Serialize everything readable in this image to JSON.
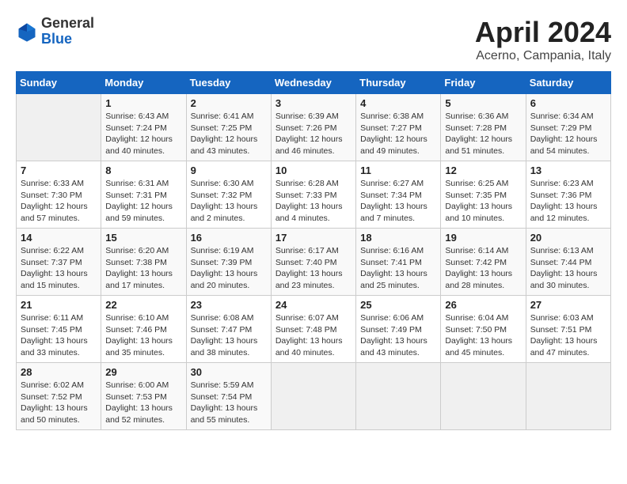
{
  "header": {
    "logo": {
      "general": "General",
      "blue": "Blue"
    },
    "month": "April 2024",
    "location": "Acerno, Campania, Italy"
  },
  "weekdays": [
    "Sunday",
    "Monday",
    "Tuesday",
    "Wednesday",
    "Thursday",
    "Friday",
    "Saturday"
  ],
  "weeks": [
    [
      {
        "day": "",
        "info": ""
      },
      {
        "day": "1",
        "info": "Sunrise: 6:43 AM\nSunset: 7:24 PM\nDaylight: 12 hours\nand 40 minutes."
      },
      {
        "day": "2",
        "info": "Sunrise: 6:41 AM\nSunset: 7:25 PM\nDaylight: 12 hours\nand 43 minutes."
      },
      {
        "day": "3",
        "info": "Sunrise: 6:39 AM\nSunset: 7:26 PM\nDaylight: 12 hours\nand 46 minutes."
      },
      {
        "day": "4",
        "info": "Sunrise: 6:38 AM\nSunset: 7:27 PM\nDaylight: 12 hours\nand 49 minutes."
      },
      {
        "day": "5",
        "info": "Sunrise: 6:36 AM\nSunset: 7:28 PM\nDaylight: 12 hours\nand 51 minutes."
      },
      {
        "day": "6",
        "info": "Sunrise: 6:34 AM\nSunset: 7:29 PM\nDaylight: 12 hours\nand 54 minutes."
      }
    ],
    [
      {
        "day": "7",
        "info": "Sunrise: 6:33 AM\nSunset: 7:30 PM\nDaylight: 12 hours\nand 57 minutes."
      },
      {
        "day": "8",
        "info": "Sunrise: 6:31 AM\nSunset: 7:31 PM\nDaylight: 12 hours\nand 59 minutes."
      },
      {
        "day": "9",
        "info": "Sunrise: 6:30 AM\nSunset: 7:32 PM\nDaylight: 13 hours\nand 2 minutes."
      },
      {
        "day": "10",
        "info": "Sunrise: 6:28 AM\nSunset: 7:33 PM\nDaylight: 13 hours\nand 4 minutes."
      },
      {
        "day": "11",
        "info": "Sunrise: 6:27 AM\nSunset: 7:34 PM\nDaylight: 13 hours\nand 7 minutes."
      },
      {
        "day": "12",
        "info": "Sunrise: 6:25 AM\nSunset: 7:35 PM\nDaylight: 13 hours\nand 10 minutes."
      },
      {
        "day": "13",
        "info": "Sunrise: 6:23 AM\nSunset: 7:36 PM\nDaylight: 13 hours\nand 12 minutes."
      }
    ],
    [
      {
        "day": "14",
        "info": "Sunrise: 6:22 AM\nSunset: 7:37 PM\nDaylight: 13 hours\nand 15 minutes."
      },
      {
        "day": "15",
        "info": "Sunrise: 6:20 AM\nSunset: 7:38 PM\nDaylight: 13 hours\nand 17 minutes."
      },
      {
        "day": "16",
        "info": "Sunrise: 6:19 AM\nSunset: 7:39 PM\nDaylight: 13 hours\nand 20 minutes."
      },
      {
        "day": "17",
        "info": "Sunrise: 6:17 AM\nSunset: 7:40 PM\nDaylight: 13 hours\nand 23 minutes."
      },
      {
        "day": "18",
        "info": "Sunrise: 6:16 AM\nSunset: 7:41 PM\nDaylight: 13 hours\nand 25 minutes."
      },
      {
        "day": "19",
        "info": "Sunrise: 6:14 AM\nSunset: 7:42 PM\nDaylight: 13 hours\nand 28 minutes."
      },
      {
        "day": "20",
        "info": "Sunrise: 6:13 AM\nSunset: 7:44 PM\nDaylight: 13 hours\nand 30 minutes."
      }
    ],
    [
      {
        "day": "21",
        "info": "Sunrise: 6:11 AM\nSunset: 7:45 PM\nDaylight: 13 hours\nand 33 minutes."
      },
      {
        "day": "22",
        "info": "Sunrise: 6:10 AM\nSunset: 7:46 PM\nDaylight: 13 hours\nand 35 minutes."
      },
      {
        "day": "23",
        "info": "Sunrise: 6:08 AM\nSunset: 7:47 PM\nDaylight: 13 hours\nand 38 minutes."
      },
      {
        "day": "24",
        "info": "Sunrise: 6:07 AM\nSunset: 7:48 PM\nDaylight: 13 hours\nand 40 minutes."
      },
      {
        "day": "25",
        "info": "Sunrise: 6:06 AM\nSunset: 7:49 PM\nDaylight: 13 hours\nand 43 minutes."
      },
      {
        "day": "26",
        "info": "Sunrise: 6:04 AM\nSunset: 7:50 PM\nDaylight: 13 hours\nand 45 minutes."
      },
      {
        "day": "27",
        "info": "Sunrise: 6:03 AM\nSunset: 7:51 PM\nDaylight: 13 hours\nand 47 minutes."
      }
    ],
    [
      {
        "day": "28",
        "info": "Sunrise: 6:02 AM\nSunset: 7:52 PM\nDaylight: 13 hours\nand 50 minutes."
      },
      {
        "day": "29",
        "info": "Sunrise: 6:00 AM\nSunset: 7:53 PM\nDaylight: 13 hours\nand 52 minutes."
      },
      {
        "day": "30",
        "info": "Sunrise: 5:59 AM\nSunset: 7:54 PM\nDaylight: 13 hours\nand 55 minutes."
      },
      {
        "day": "",
        "info": ""
      },
      {
        "day": "",
        "info": ""
      },
      {
        "day": "",
        "info": ""
      },
      {
        "day": "",
        "info": ""
      }
    ]
  ]
}
